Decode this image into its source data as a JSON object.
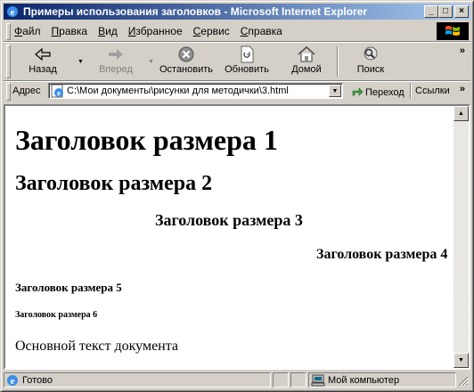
{
  "window": {
    "title": "Примеры использования заголовков - Microsoft Internet Explorer",
    "minimize_symbol": "_",
    "maximize_symbol": "□",
    "close_symbol": "×"
  },
  "menu": {
    "items": [
      {
        "hotkey": "Ф",
        "rest": "айл"
      },
      {
        "hotkey": "П",
        "rest": "равка"
      },
      {
        "hotkey": "В",
        "rest": "ид"
      },
      {
        "hotkey": "И",
        "rest": "збранное"
      },
      {
        "hotkey": "С",
        "rest": "ервис"
      },
      {
        "hotkey": "С",
        "rest": "правка"
      }
    ]
  },
  "toolbar": {
    "back_label": "Назад",
    "forward_label": "Вперед",
    "stop_label": "Остановить",
    "refresh_label": "Обновить",
    "home_label": "Домой",
    "search_label": "Поиск",
    "more_symbol": "»"
  },
  "address": {
    "label": "Адрес",
    "value": "C:\\Мои документы\\рисунки для методички\\3.html",
    "go_label": "Переход",
    "links_label": "Ссылки",
    "links_more": "»"
  },
  "page": {
    "h1": "Заголовок размера 1",
    "h2": "Заголовок размера 2",
    "h3": "Заголовок размера 3",
    "h4": "Заголовок размера 4",
    "h5": "Заголовок размера 5",
    "h6": "Заголовок размера 6",
    "body_text": "Основной текст документа"
  },
  "status": {
    "text": "Готово",
    "zone": "Мой компьютер"
  },
  "colors": {
    "title_start": "#0a246a",
    "title_end": "#a6caf0",
    "chrome": "#d4d0c8"
  }
}
